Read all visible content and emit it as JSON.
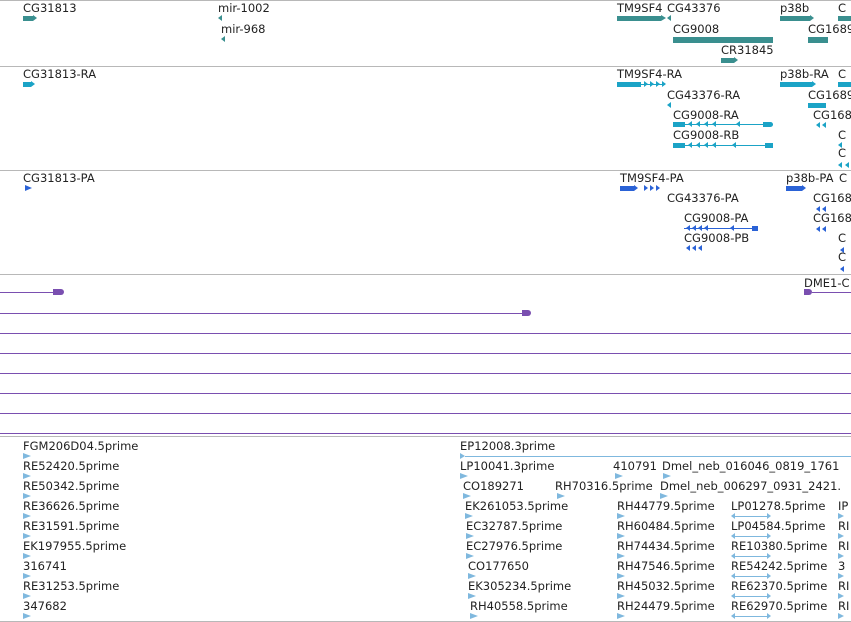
{
  "colors": {
    "gene": "#3a8f8f",
    "transcript": "#1ba3c6",
    "protein": "#2a62d6",
    "match": "#7a4fb0",
    "est": "#7fb8de",
    "border": "#b8b8b8"
  },
  "gene_track": {
    "labels": [
      "CG31813",
      "mir-1002",
      "mir-968",
      "TM9SF4",
      "CG43376",
      "CG9008",
      "CR31845",
      "p38b",
      "CG1689"
    ]
  },
  "transcript_track": {
    "labels": [
      "CG31813-RA",
      "TM9SF4-RA",
      "p38b-RA",
      "CG1689",
      "CG43376-RA",
      "CG168",
      "CG9008-RA",
      "CG9008-RB"
    ]
  },
  "protein_track": {
    "labels": [
      "CG31813-PA",
      "TM9SF4-PA",
      "p38b-PA",
      "CG43376-PA",
      "CG168",
      "CG168",
      "CG9008-PA",
      "CG9008-PB"
    ]
  },
  "match_track": {
    "labels": [
      "DME1-C"
    ]
  },
  "est_track": {
    "labels": [
      "FGM206D04.5prime",
      "RE52420.5prime",
      "RE50342.5prime",
      "RE36626.5prime",
      "RE31591.5prime",
      "EK197955.5prime",
      "316741",
      "RE31253.5prime",
      "347682",
      "EP12008.3prime",
      "LP10041.3prime",
      "CO189271",
      "EK261053.5prime",
      "EC32787.5prime",
      "EC27976.5prime",
      "CO177650",
      "EK305234.5prime",
      "RH40558.5prime",
      "410791",
      "Dmel_neb_016046_0819_1761",
      "RH70316.5prime",
      "Dmel_neb_006297_0931_2421.",
      "RH44779.5prime",
      "RH60484.5prime",
      "RH74434.5prime",
      "RH47546.5prime",
      "RH45032.5prime",
      "RH24479.5prime",
      "LP01278.5prime",
      "LP04584.5prime",
      "RE10380.5prime",
      "RE54242.5prime",
      "RE62370.5prime",
      "RE62970.5prime",
      "IP",
      "RI",
      "RI",
      "3",
      "RI",
      "RI"
    ]
  }
}
